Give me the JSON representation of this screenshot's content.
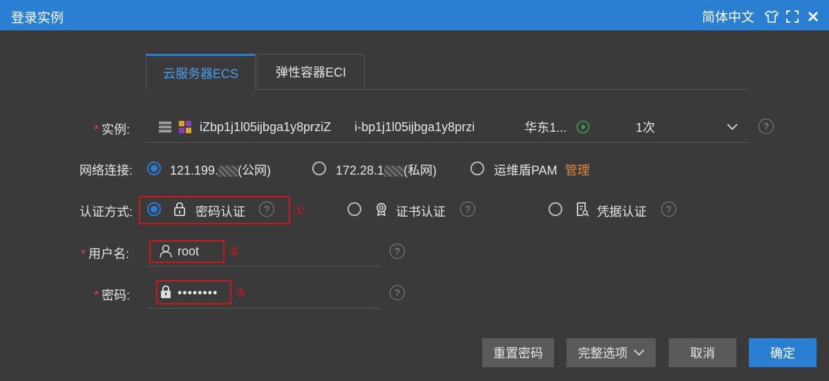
{
  "window": {
    "title": "登录实例",
    "language": "简体中文"
  },
  "tabs": [
    {
      "label": "云服务器ECS",
      "active": true
    },
    {
      "label": "弹性容器ECI",
      "active": false
    }
  ],
  "instance": {
    "label": "实例:",
    "name": "iZbp1j1l05ijbga1y8przi Z",
    "name_display": "iZbp1j1l05ijbga1y8prziZ",
    "id": "i-bp1j1l05ijbga1y8przi",
    "region": "华东1...",
    "count": "1次"
  },
  "network": {
    "label": "网络连接:",
    "options": [
      {
        "label": "121.199.",
        "suffix": "(公网)",
        "selected": true
      },
      {
        "label": "172.28.1",
        "suffix": "(私网)",
        "selected": false
      },
      {
        "label": "运维盾PAM",
        "selected": false,
        "link": "管理"
      }
    ]
  },
  "auth": {
    "label": "认证方式:",
    "options": [
      {
        "label": "密码认证",
        "selected": true
      },
      {
        "label": "证书认证",
        "selected": false
      },
      {
        "label": "凭据认证",
        "selected": false
      }
    ]
  },
  "username": {
    "label": "用户名:",
    "value": "root"
  },
  "password": {
    "label": "密码:",
    "value": "••••••••"
  },
  "annotations": [
    "①",
    "②",
    "③"
  ],
  "buttons": {
    "reset_password": "重置密码",
    "full_options": "完整选项",
    "cancel": "取消",
    "confirm": "确定"
  },
  "colors": {
    "titlebar": "#2b7fd2",
    "background": "#3a3a3a",
    "accent": "#2b7fd2",
    "annotation_red": "#d01818",
    "link_orange": "#e08a3a",
    "region_status": "#2ea84a"
  }
}
